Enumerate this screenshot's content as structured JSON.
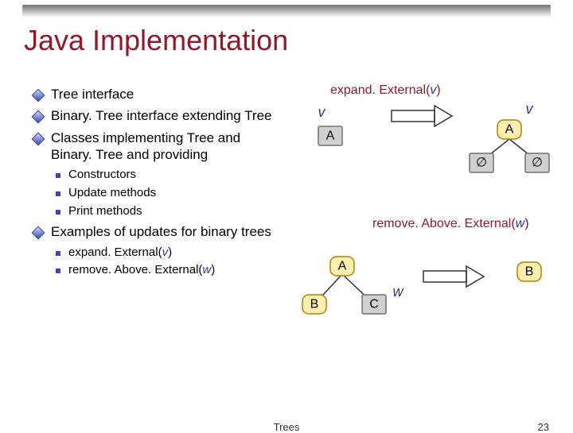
{
  "title": "Java Implementation",
  "bullets": {
    "b1": "Tree interface",
    "b2": "Binary. Tree interface extending Tree",
    "b3": "Classes implementing Tree and Binary. Tree and providing",
    "b3_sub": {
      "s1": "Constructors",
      "s2": "Update methods",
      "s3": "Print methods"
    },
    "b4": "Examples of updates for binary trees",
    "b4_sub": {
      "s1_pre": "expand. External(",
      "s1_var": "v",
      "s1_post": ")",
      "s2_pre": "remove. Above. External(",
      "s2_var": "w",
      "s2_post": ")"
    }
  },
  "diagram": {
    "op1_pre": "expand. External(",
    "op1_var": "v",
    "op1_post": ")",
    "op2_pre": "remove. Above. External(",
    "op2_var": "w",
    "op2_post": ")",
    "labels": {
      "A": "A",
      "B": "B",
      "C": "C",
      "v": "v",
      "w": "w",
      "empty": "∅"
    }
  },
  "footer": {
    "center": "Trees",
    "right": "23"
  }
}
